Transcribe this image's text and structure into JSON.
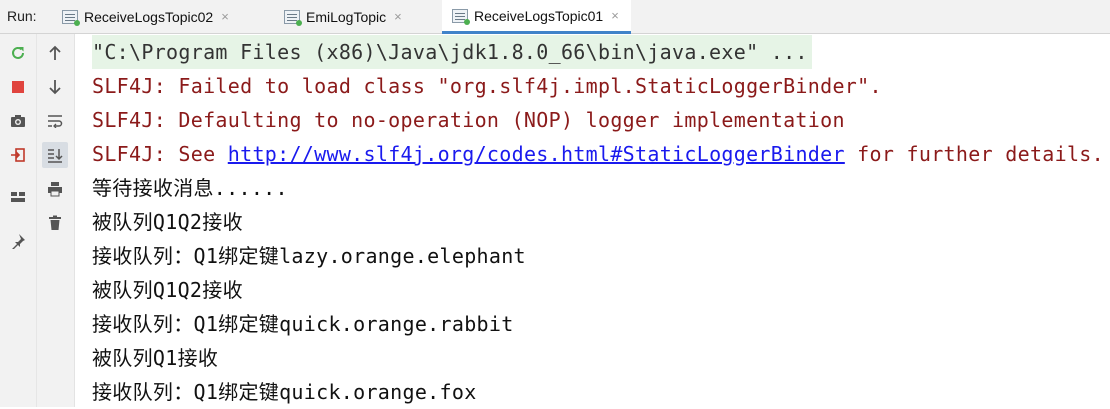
{
  "run": {
    "label": "Run:",
    "tabs": [
      {
        "label": "ReceiveLogsTopic02",
        "active": false
      },
      {
        "label": "EmiLogTopic",
        "active": false
      },
      {
        "label": "ReceiveLogsTopic01",
        "active": true
      }
    ],
    "close_glyph": "×"
  },
  "toolbar": {
    "left": [
      "rerun-icon",
      "stop-icon",
      "camera-icon",
      "exit-icon",
      "layout-icon",
      "pin-icon"
    ],
    "right": [
      "arrow-up-icon",
      "arrow-down-icon",
      "soft-wrap-icon",
      "scroll-to-end-icon",
      "print-icon",
      "trash-icon"
    ],
    "colors": {
      "rerun": "#4caf50",
      "stop": "#e0443e"
    }
  },
  "console": {
    "command": "\"C:\\Program Files (x86)\\Java\\jdk1.8.0_66\\bin\\java.exe\" ...",
    "slf4j_1": "SLF4J: Failed to load class \"org.slf4j.impl.StaticLoggerBinder\".",
    "slf4j_2": "SLF4J: Defaulting to no-operation (NOP) logger implementation",
    "slf4j_3_prefix": "SLF4J: See ",
    "slf4j_3_link": "http://www.slf4j.org/codes.html#StaticLoggerBinder",
    "slf4j_3_suffix": " for further details.",
    "out_1": "等待接收消息......",
    "out_2": "被队列Q1Q2接收",
    "out_3": "接收队列：Q1绑定键lazy.orange.elephant",
    "out_4": "被队列Q1Q2接收",
    "out_5": "接收队列：Q1绑定键quick.orange.rabbit",
    "out_6": "被队列Q1接收",
    "out_7": "接收队列：Q1绑定键quick.orange.fox",
    "colors": {
      "error": "#8b1a1a",
      "link": "#1a1aee",
      "command_bg": "#e6f4e6"
    }
  }
}
